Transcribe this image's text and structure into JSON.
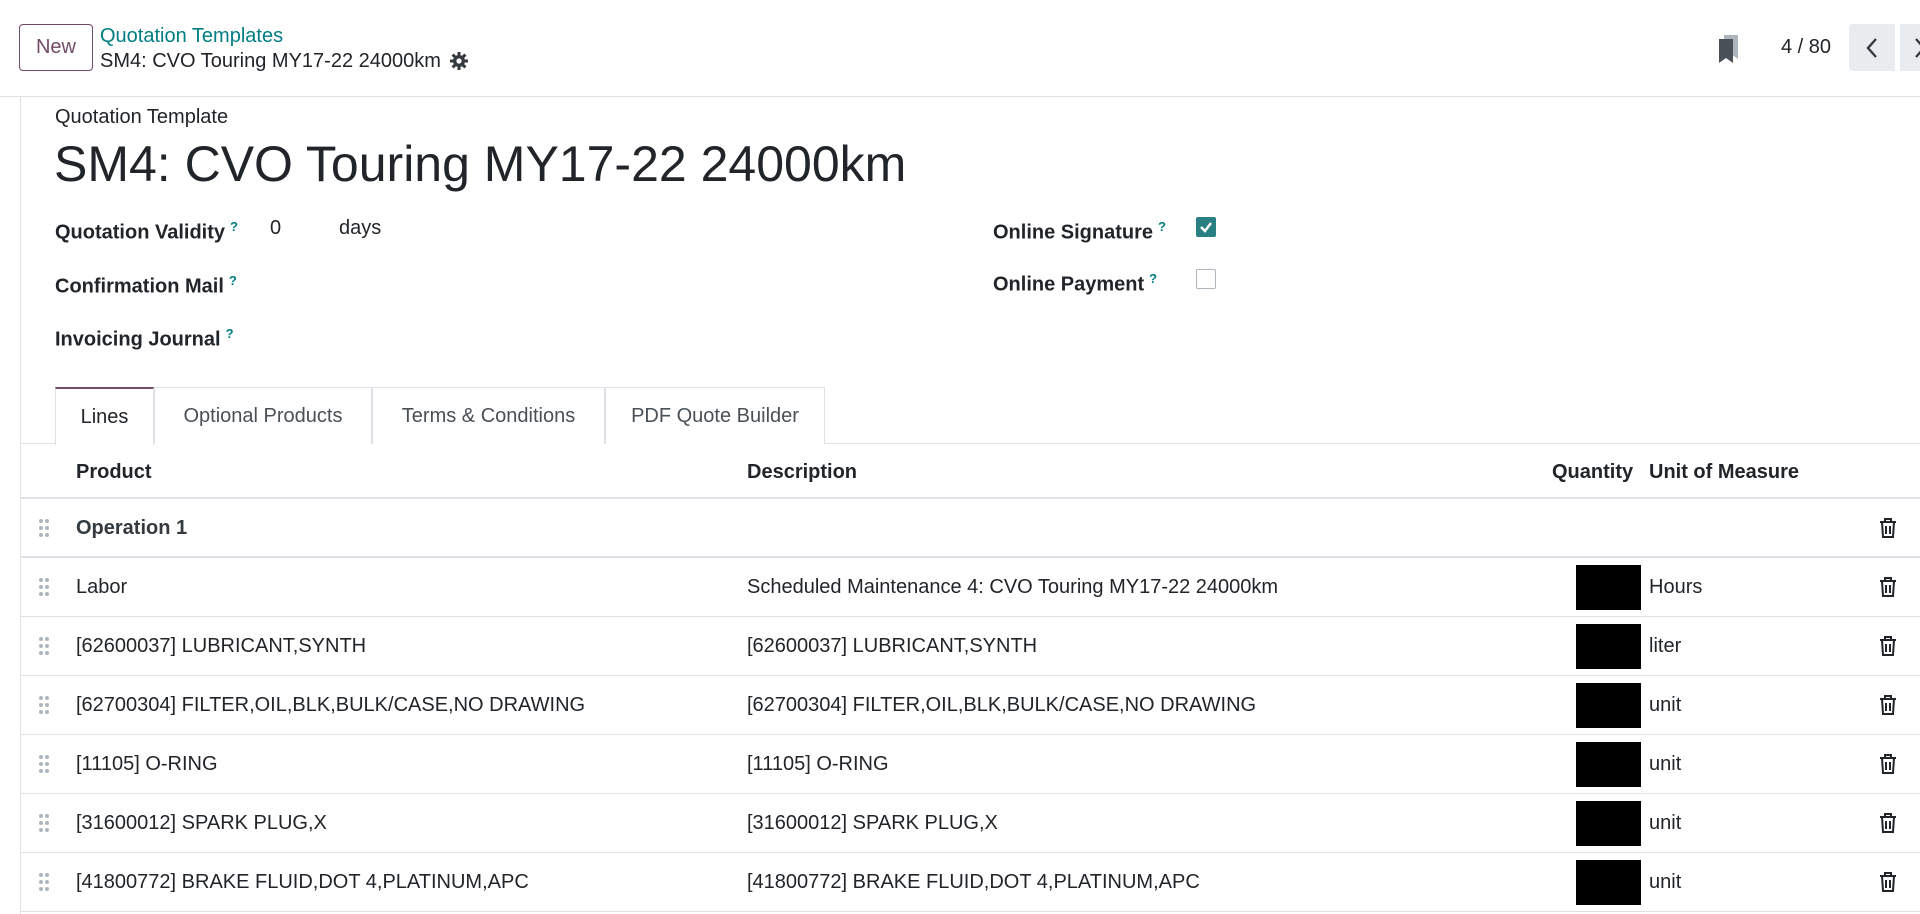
{
  "control_panel": {
    "new_button": "New",
    "breadcrumb_parent": "Quotation Templates",
    "breadcrumb_current": "SM4: CVO Touring MY17-22 24000km",
    "pager_value": "4 / 80"
  },
  "form": {
    "record_label": "Quotation Template",
    "title": "SM4: CVO Touring MY17-22 24000km",
    "help_mark": "?",
    "fields": {
      "validity_label": "Quotation Validity",
      "validity_value": "0",
      "validity_unit": "days",
      "confirmation_mail_label": "Confirmation Mail",
      "invoicing_journal_label": "Invoicing Journal",
      "online_signature_label": "Online Signature",
      "online_signature_checked": true,
      "online_payment_label": "Online Payment",
      "online_payment_checked": false
    }
  },
  "tabs": [
    {
      "label": "Lines",
      "active": true
    },
    {
      "label": "Optional Products",
      "active": false
    },
    {
      "label": "Terms & Conditions",
      "active": false
    },
    {
      "label": "PDF Quote Builder",
      "active": false
    }
  ],
  "table": {
    "columns": {
      "product": "Product",
      "description": "Description",
      "quantity": "Quantity",
      "uom": "Unit of Measure"
    },
    "section": "Operation 1",
    "rows": [
      {
        "product": "Labor",
        "description": "Scheduled Maintenance 4: CVO Touring MY17-22 24000km",
        "uom": "Hours"
      },
      {
        "product": "[62600037] LUBRICANT,SYNTH",
        "description": "[62600037] LUBRICANT,SYNTH",
        "uom": "liter"
      },
      {
        "product": "[62700304] FILTER,OIL,BLK,BULK/CASE,NO DRAWING",
        "description": "[62700304] FILTER,OIL,BLK,BULK/CASE,NO DRAWING",
        "uom": "unit"
      },
      {
        "product": "[11105] O-RING",
        "description": "[11105] O-RING",
        "uom": "unit"
      },
      {
        "product": "[31600012] SPARK PLUG,X",
        "description": "[31600012] SPARK PLUG,X",
        "uom": "unit"
      },
      {
        "product": "[41800772] BRAKE FLUID,DOT 4,PLATINUM,APC",
        "description": "[41800772] BRAKE FLUID,DOT 4,PLATINUM,APC",
        "uom": "unit"
      }
    ]
  },
  "colors": {
    "brand": "#714b67",
    "link": "#017e84",
    "checkbox_checked": "#2a7f83"
  }
}
